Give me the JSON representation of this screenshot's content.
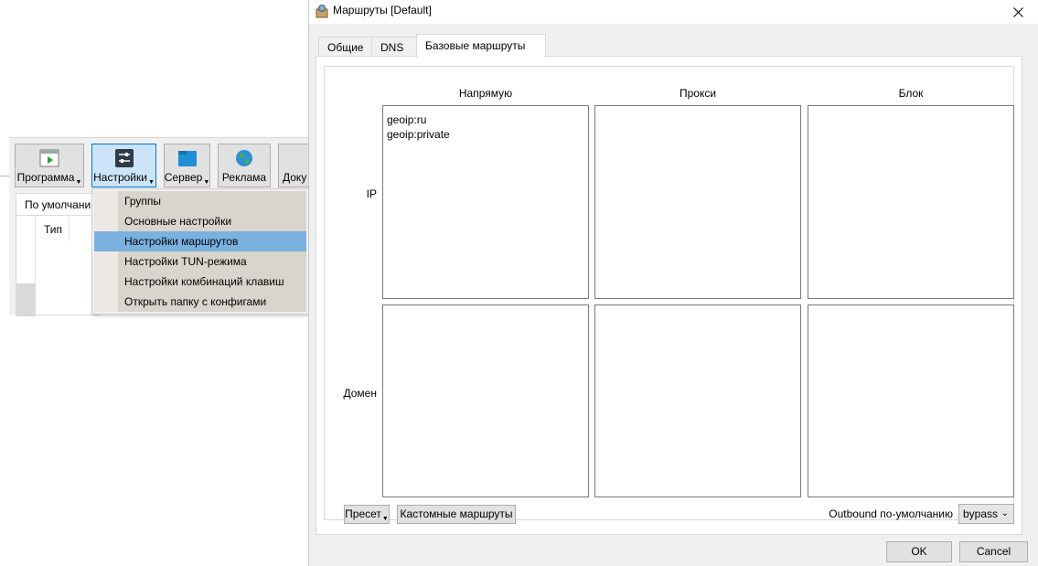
{
  "main_window": {
    "toolbar": [
      {
        "label": "Программа",
        "has_dropdown": true,
        "icon": "play-app-icon"
      },
      {
        "label": "Настройки",
        "has_dropdown": true,
        "icon": "settings-sliders-icon",
        "active": true
      },
      {
        "label": "Сервер",
        "has_dropdown": true,
        "icon": "server-folder-icon"
      },
      {
        "label": "Реклама",
        "has_dropdown": false,
        "icon": "globe-icon"
      },
      {
        "label": "Доку",
        "has_dropdown": false,
        "icon": "document-icon"
      }
    ],
    "tab_default": "По умолчани",
    "column_type": "Тип"
  },
  "settings_menu": {
    "items": [
      {
        "label": "Группы"
      },
      {
        "label": "Основные настройки"
      },
      {
        "label": "Настройки маршрутов",
        "highlighted": true
      },
      {
        "label": "Настройки TUN-режима"
      },
      {
        "label": "Настройки комбинаций клавиш"
      },
      {
        "label": "Открыть папку с конфигами"
      }
    ]
  },
  "dialog": {
    "title": "Маршруты [Default]",
    "tabs": [
      {
        "label": "Общие"
      },
      {
        "label": "DNS"
      },
      {
        "label": "Базовые маршруты",
        "active": true
      }
    ],
    "columns": {
      "direct": "Напрямую",
      "proxy": "Прокси",
      "block": "Блок"
    },
    "rows": {
      "ip": "IP",
      "domain": "Домен"
    },
    "ip_direct_lines": [
      "geoip:ru",
      "geoip:private"
    ],
    "preset_button": "Пресет",
    "custom_routes_button": "Кастомные маршруты",
    "outbound_label": "Outbound по-умолчанию",
    "outbound_value": "bypass",
    "ok_button": "OK",
    "cancel_button": "Cancel"
  },
  "colors": {
    "menu_highlight": "#7ab1e0",
    "active_toolbar": "#cce4f7",
    "window_bg": "#f0f0f0"
  }
}
